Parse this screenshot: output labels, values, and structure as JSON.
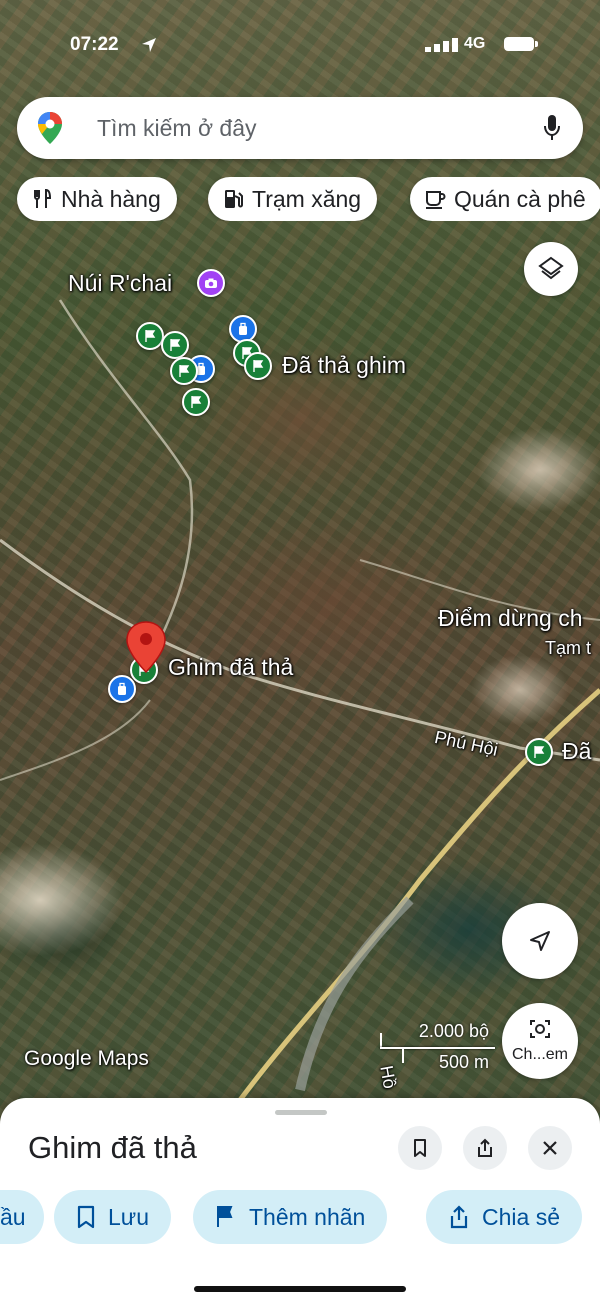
{
  "status_bar": {
    "time": "07:22",
    "network": "4G"
  },
  "search": {
    "placeholder": "Tìm kiếm ở đây"
  },
  "chips": [
    {
      "label": "Nhà hàng",
      "icon": "restaurant-icon"
    },
    {
      "label": "Trạm xăng",
      "icon": "gas-station-icon"
    },
    {
      "label": "Quán cà phê",
      "icon": "coffee-icon"
    }
  ],
  "map": {
    "labels": {
      "mountain": "Núi R'chai",
      "dropped_pin_cluster": "Đã thả ghim",
      "dropped_pin": "Ghim đã thả",
      "stop": "Điểm dừng ch",
      "stop_sub": "Tạm t",
      "place": "Phú Hội",
      "pin_right": "Đã",
      "road": "Hồ"
    },
    "attribution": "Google Maps",
    "scale": {
      "imperial": "2.000 bộ",
      "metric": "500 m"
    },
    "lens_label": "Ch...em"
  },
  "sheet": {
    "title": "Ghim đã thả",
    "actions": [
      {
        "label": "ầu",
        "icon": "directions-icon"
      },
      {
        "label": "Lưu",
        "icon": "bookmark-icon"
      },
      {
        "label": "Thêm nhãn",
        "icon": "flag-icon"
      },
      {
        "label": "Chia sẻ",
        "icon": "share-icon"
      }
    ]
  },
  "colors": {
    "accent_blue": "#1a73e8",
    "pin_green": "#188038",
    "marker_red": "#ea4335",
    "action_bg": "#d3eef7",
    "action_text": "#00509a"
  }
}
